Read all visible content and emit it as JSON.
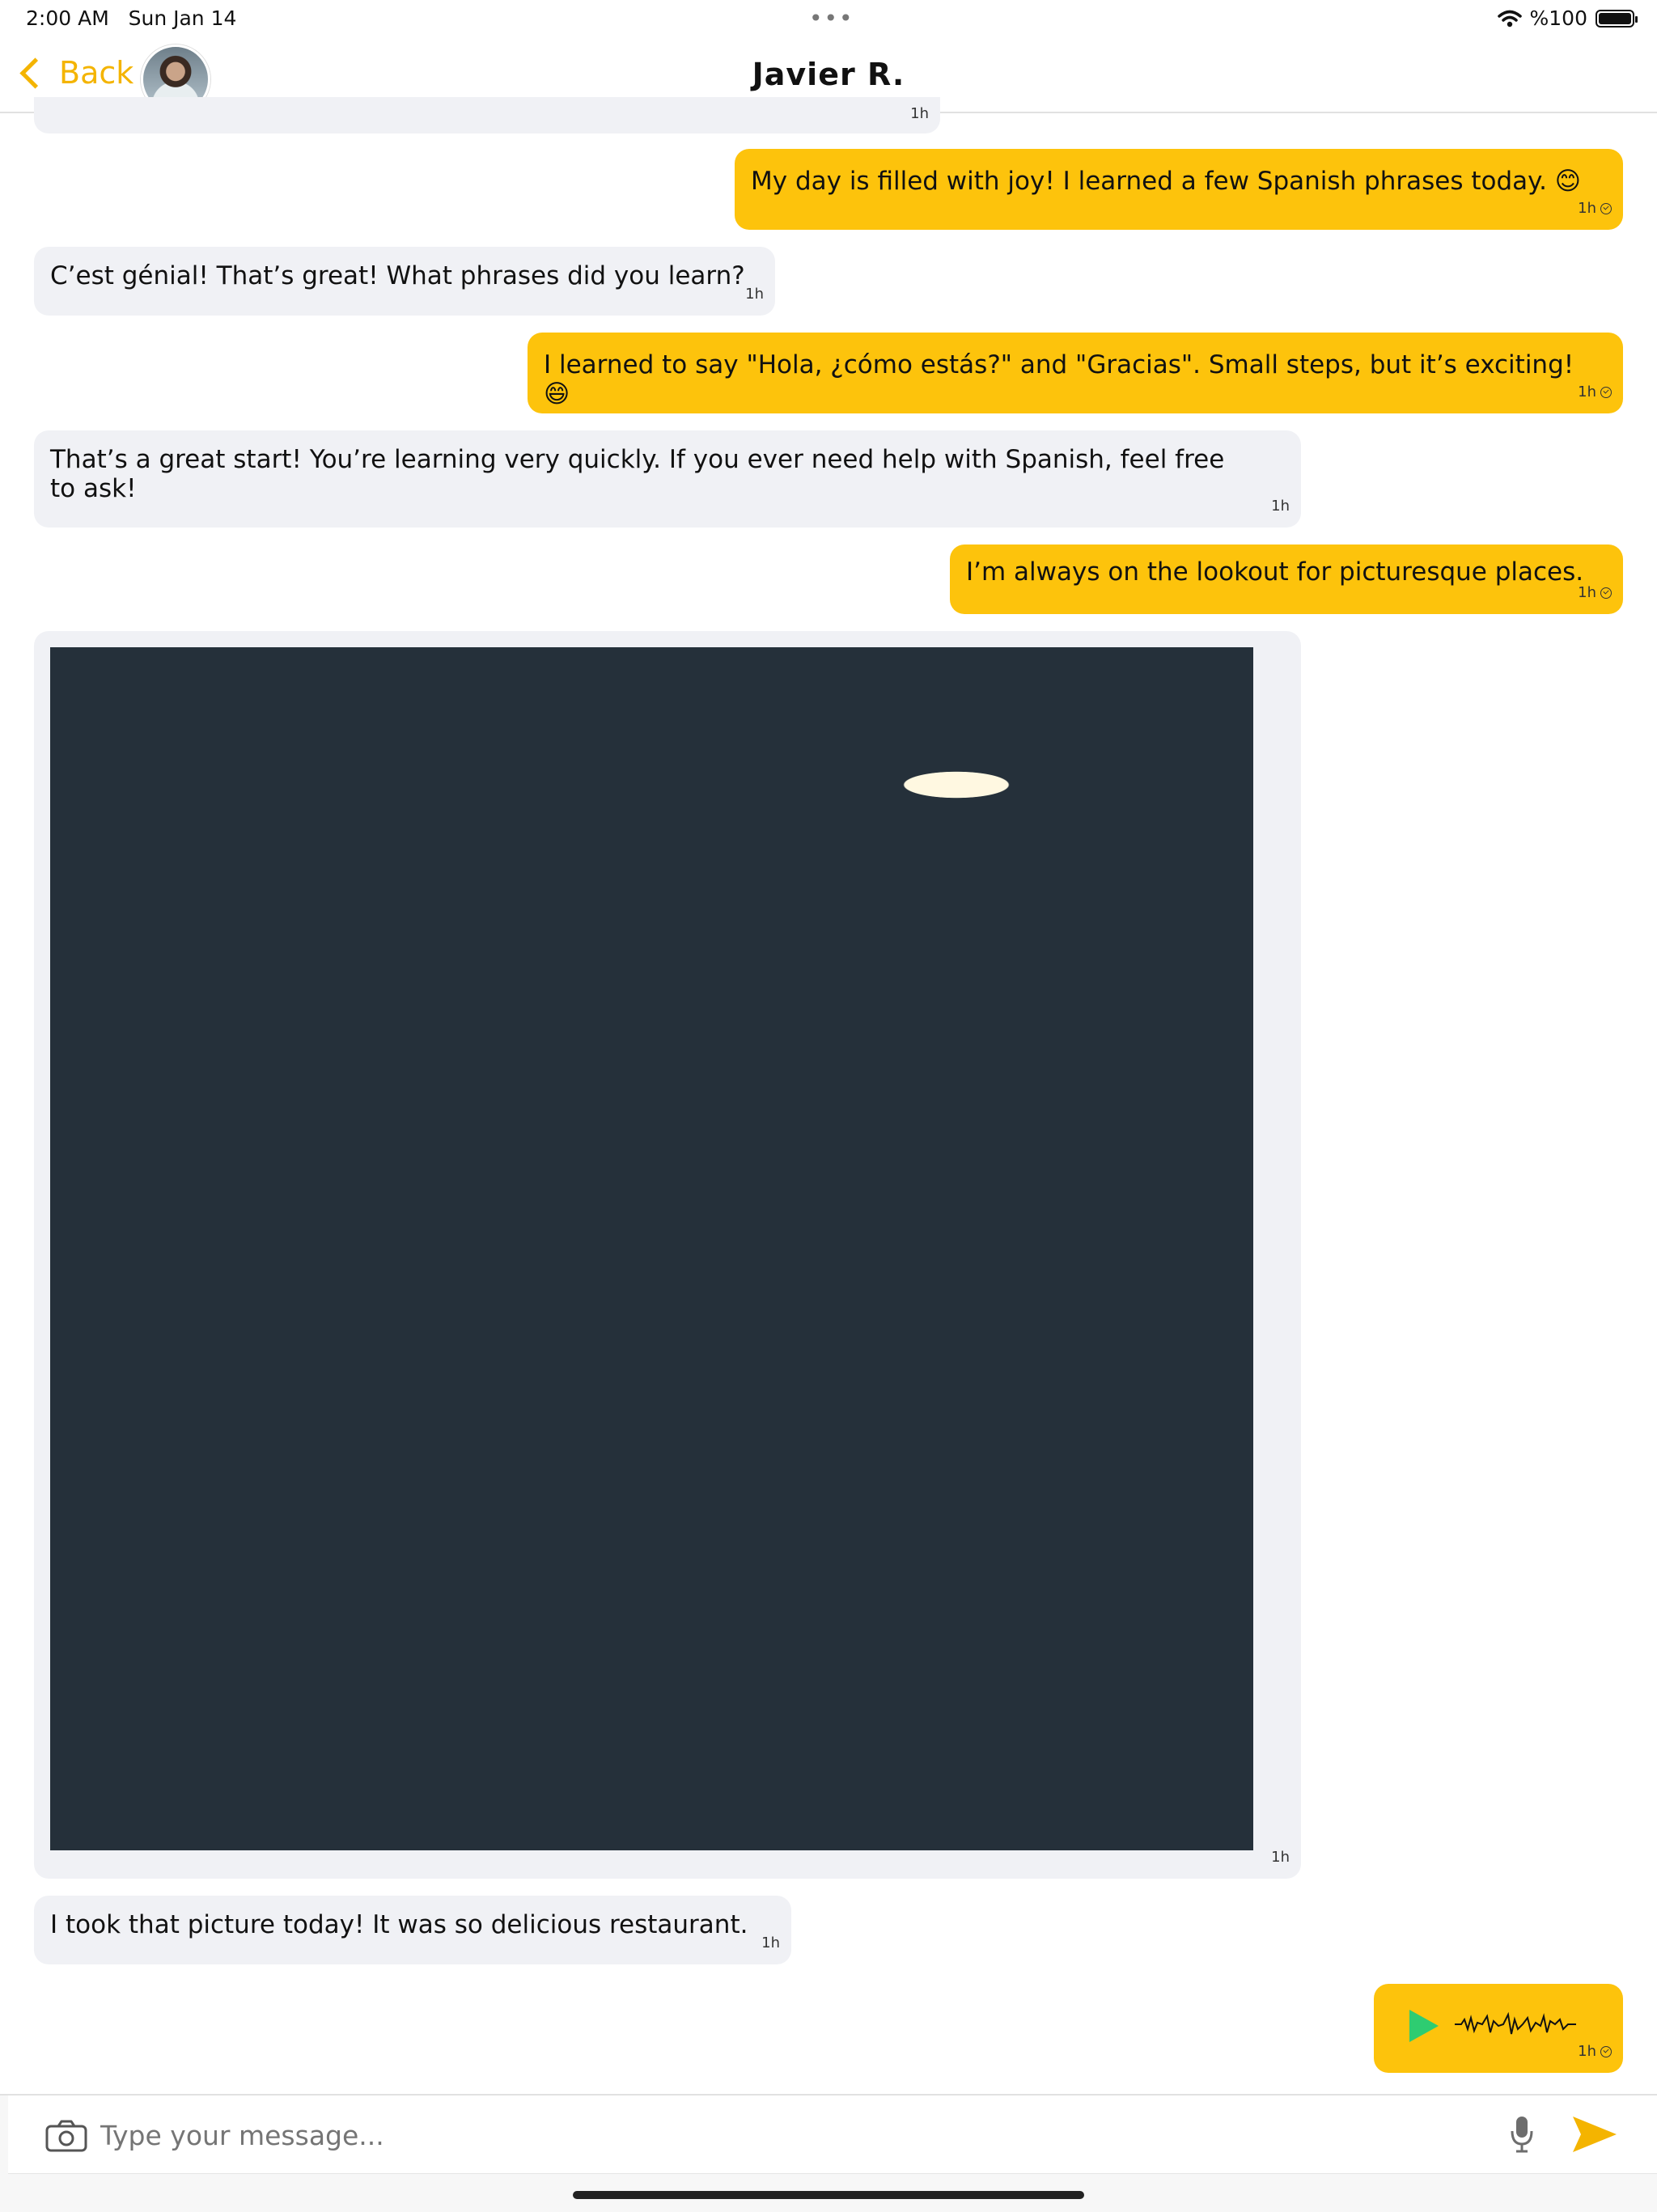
{
  "status_bar": {
    "time": "2:00 AM",
    "date": "Sun Jan 14",
    "dots": "•••",
    "battery": "%100",
    "icons": [
      "wifi-icon",
      "battery-icon"
    ]
  },
  "nav": {
    "back_label": "Back",
    "title": "Javier R."
  },
  "colors": {
    "accent": "#f4b400",
    "outgoing_bubble": "#fdc30c",
    "incoming_bubble": "#f0f1f5",
    "play": "#2ecc71"
  },
  "messages": {
    "m0": {
      "time": "1h"
    },
    "m1": {
      "text": "My day is filled with joy! I learned a few Spanish phrases today. 😊",
      "time": "1h"
    },
    "m2": {
      "text": "C’est génial! That’s great! What phrases did you learn?",
      "time": "1h"
    },
    "m3": {
      "text": "I learned to say \"Hola, ¿cómo estás?\" and \"Gracias\". Small steps, but it’s exciting! 😄",
      "time": "1h"
    },
    "m4": {
      "text": "That’s a great start! You’re learning very quickly. If you ever need help with Spanish, feel free to ask!",
      "time": "1h"
    },
    "m5": {
      "text": "I’m always on the lookout for picturesque places.",
      "time": "1h"
    },
    "m6": {
      "image": "restaurant-kitchen-photo",
      "time": "1h"
    },
    "m7": {
      "text": "I took that picture today! It was so delicious restaurant.",
      "time": "1h"
    },
    "m8": {
      "voice": "voice-message",
      "time": "1h"
    }
  },
  "composer": {
    "placeholder": "Type your message..."
  }
}
